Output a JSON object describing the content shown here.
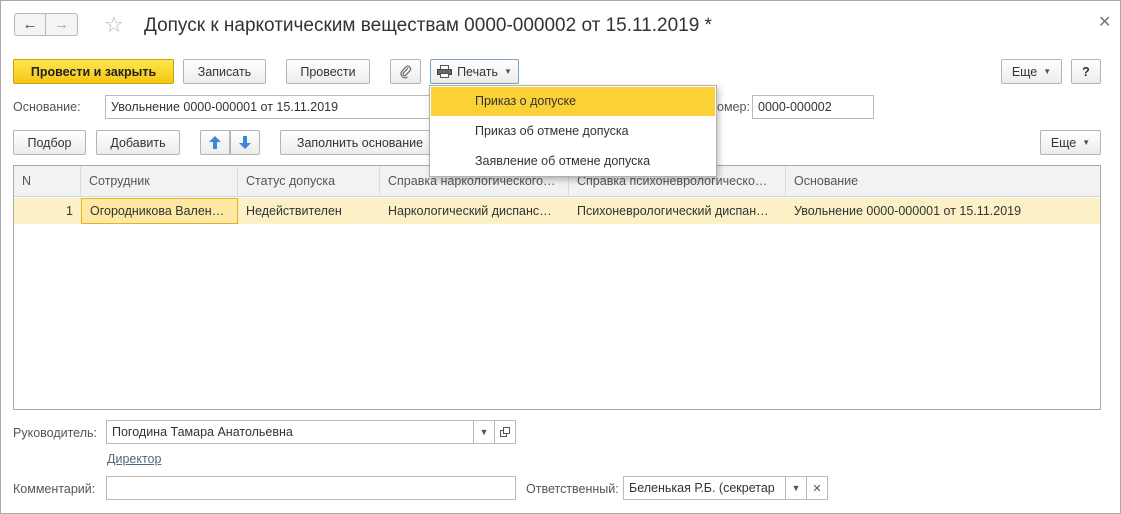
{
  "window": {
    "title": "Допуск к наркотическим веществам 0000-000002 от 15.11.2019 *",
    "icons": [
      "arrow-left-icon",
      "arrow-right-icon",
      "star-icon",
      "close-icon"
    ]
  },
  "toolbar": {
    "post_close": "Провести и закрыть",
    "save": "Записать",
    "post": "Провести",
    "print": "Печать",
    "more": "Еще",
    "help": "?"
  },
  "form": {
    "basis_label": "Основание:",
    "basis_value": "Увольнение 0000-000001 от 15.11.2019",
    "number_label": "Номер:",
    "number_label_visible": "омер:",
    "number_value": "0000-000002"
  },
  "table_toolbar": {
    "pick": "Подбор",
    "add": "Добавить",
    "fill_basis": "Заполнить основание",
    "more": "Еще"
  },
  "table": {
    "columns": [
      "N",
      "Сотрудник",
      "Статус допуска",
      "Справка наркологического…",
      "Справка психоневрологическо…",
      "Основание"
    ],
    "rows": [
      {
        "n": "1",
        "employee": "Огородникова Вален…",
        "status": "Недействителен",
        "narc_cert": "Наркологический диспанс…",
        "psych_cert": "Психоневрологический диспан…",
        "basis": "Увольнение 0000-000001 от 15.11.2019"
      }
    ]
  },
  "print_menu": {
    "items": [
      "Приказ о допуске",
      "Приказ об отмене допуска",
      "Заявление об отмене допуска"
    ],
    "selected_index": 0
  },
  "footer": {
    "manager_label": "Руководитель:",
    "manager_value": "Погодина Тамара Анатольевна",
    "manager_position": "Директор",
    "comment_label": "Комментарий:",
    "comment_value": "",
    "responsible_label": "Ответственный:",
    "responsible_value": "Беленькая Р.Б. (секретар"
  },
  "colors": {
    "primary_button": "#f6c613",
    "selected_row": "#fbf0c6",
    "menu_highlight": "#fbd136",
    "link": "#4f6a7f"
  }
}
